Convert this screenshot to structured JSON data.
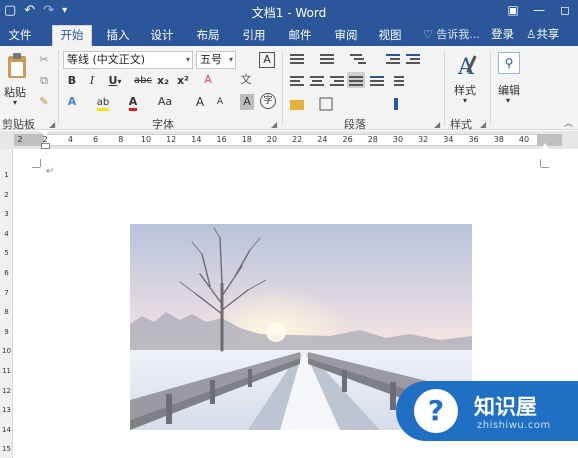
{
  "window": {
    "title": "文档1 - Word",
    "qat": {
      "undo_icon": "↶",
      "redo_icon": "↷",
      "customize": "▾"
    },
    "buttons": {
      "ribbon_options": "▣",
      "minimize": "—",
      "maximize": "◻"
    }
  },
  "tabs": [
    {
      "label": "文件"
    },
    {
      "label": "开始"
    },
    {
      "label": "插入"
    },
    {
      "label": "设计"
    },
    {
      "label": "布局"
    },
    {
      "label": "引用"
    },
    {
      "label": "邮件"
    },
    {
      "label": "审阅"
    },
    {
      "label": "视图"
    }
  ],
  "tellme": {
    "icon": "lightbulb-icon",
    "placeholder": "告诉我..."
  },
  "account": {
    "login": "登录",
    "share": "共享"
  },
  "ribbon": {
    "clipboard": {
      "paste": "粘贴",
      "group_label": "剪贴板"
    },
    "font": {
      "font_name": "等线 (中文正文)",
      "font_size": "五号",
      "group_label": "字体",
      "bold": "B",
      "italic": "I",
      "underline": "U",
      "strike": "abc",
      "subscript": "x₂",
      "superscript": "x²",
      "text_effect": "A",
      "highlight": "ab",
      "font_color": "A",
      "change_case": "Aa",
      "grow": "A",
      "shrink": "A",
      "char_shading": "A",
      "enclose": "字",
      "clear_format": "A",
      "pinyin": "文",
      "char_border": "A"
    },
    "paragraph": {
      "group_label": "段落"
    },
    "styles": {
      "label": "样式",
      "group_label": "样式"
    },
    "editing": {
      "label": "编辑"
    }
  },
  "ruler": {
    "ticks": [
      "2",
      "2",
      "4",
      "6",
      "8",
      "10",
      "12",
      "14",
      "16",
      "18",
      "20",
      "22",
      "24",
      "26",
      "28",
      "30",
      "32",
      "34",
      "36",
      "38",
      "40"
    ],
    "vticks": [
      "1",
      "2",
      "3",
      "4",
      "5",
      "6",
      "7",
      "8",
      "9",
      "10",
      "11",
      "12",
      "13",
      "14",
      "15"
    ]
  },
  "document": {
    "paragraph_mark": "↵"
  },
  "watermark": {
    "brand": "知识屋",
    "domain": "zhishiwu.com",
    "q": "?"
  },
  "colors": {
    "accent": "#2b579a",
    "ribbon_bg": "#f3f3f3",
    "watermark": "#1f6fc4"
  }
}
